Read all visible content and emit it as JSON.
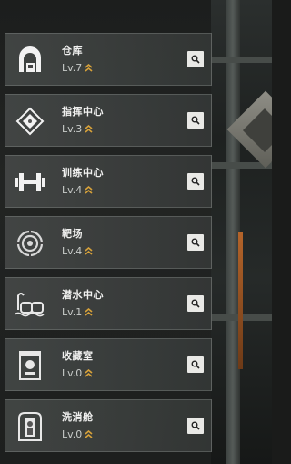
{
  "facilities": [
    {
      "icon": "warehouse-icon",
      "name": "仓库",
      "level": "Lv.7"
    },
    {
      "icon": "command-center-icon",
      "name": "指挥中心",
      "level": "Lv.3"
    },
    {
      "icon": "dumbbell-icon",
      "name": "训练中心",
      "level": "Lv.4"
    },
    {
      "icon": "target-icon",
      "name": "靶场",
      "level": "Lv.4"
    },
    {
      "icon": "diving-mask-icon",
      "name": "潜水中心",
      "level": "Lv.1"
    },
    {
      "icon": "collection-case-icon",
      "name": "收藏室",
      "level": "Lv.0"
    },
    {
      "icon": "decontamination-pod-icon",
      "name": "洗消舱",
      "level": "Lv.0"
    }
  ],
  "colors": {
    "upgrade_arrow": "#d8a23a",
    "card_border": "#969b98"
  }
}
